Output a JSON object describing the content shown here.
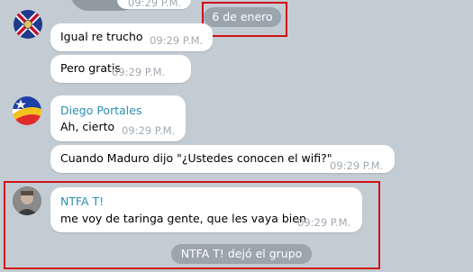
{
  "top_partial": {
    "time": "09:29 P.M."
  },
  "date_separator": "6 de enero",
  "messages": [
    {
      "text": "Igual re trucho",
      "time": "09:29 P.M."
    },
    {
      "text": "Pero gratis",
      "time": "09:29 P.M."
    },
    {
      "sender": "Diego Portales",
      "text": "Ah, cierto",
      "time": "09:29 P.M."
    },
    {
      "text": "Cuando Maduro dijo \"¿Ustedes conocen el wifi?\"",
      "time": "09:29 P.M."
    },
    {
      "sender": "NTFA T!",
      "text": "me voy de taringa gente, que les vaya bien",
      "time": "09:29 P.M."
    }
  ],
  "service_message": "NTFA T! dejó el grupo",
  "colors": {
    "background": "#c3ccd3",
    "sender_name": "#2b8fb0",
    "highlight_border": "#d0121a",
    "service_pill": "#9aa5ae"
  },
  "icons": [
    "flag-avatar",
    "chile-flag-avatar",
    "user-photo-avatar"
  ]
}
